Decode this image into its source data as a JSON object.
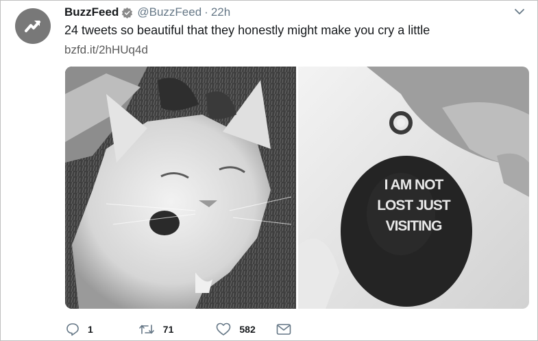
{
  "tweet": {
    "author_name": "BuzzFeed",
    "author_handle": "@BuzzFeed",
    "separator": "·",
    "timestamp": "22h",
    "text": "24 tweets so beautiful that they honestly might make you cry a little",
    "link": "bzfd.it/2hHUq4d",
    "verified": true
  },
  "media": {
    "photo_right_text": [
      "I AM NOT",
      "LOST JUST",
      "VISITING"
    ]
  },
  "actions": {
    "reply_count": "1",
    "retweet_count": "71",
    "like_count": "582"
  },
  "icons": {
    "avatar": "trending-arrow-icon",
    "verified": "verified-badge-icon",
    "menu": "chevron-down-icon",
    "reply": "reply-icon",
    "retweet": "retweet-icon",
    "like": "heart-icon",
    "dm": "envelope-icon"
  },
  "colors": {
    "avatar_bg": "#787878",
    "text_primary": "#14171a",
    "text_secondary": "#657786"
  }
}
